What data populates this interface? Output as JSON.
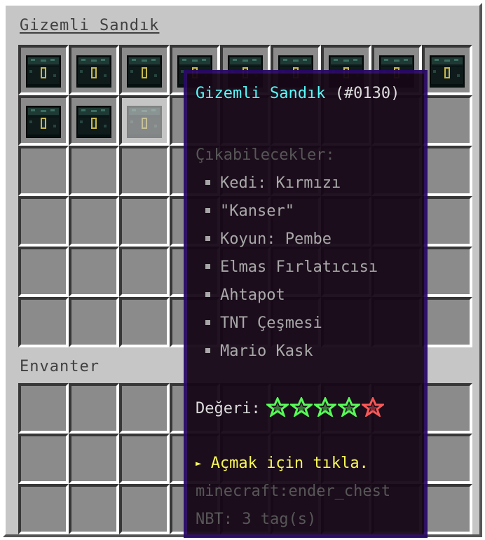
{
  "window": {
    "chest_title": "Gizemli Sandık",
    "inventory_title": "Envanter"
  },
  "chest_grid": {
    "filled_slots": 11,
    "hover_slot": 11,
    "item": "ender-chest-icon"
  },
  "tooltip": {
    "name": "Gizemli Sandık",
    "id": "(#0130)",
    "drops_header": "Çıkabilecekler:",
    "drops": [
      "Kedi: Kırmızı",
      "\"Kanser\"",
      "Koyun: Pembe",
      "Elmas Fırlatıcısı",
      "Ahtapot",
      "TNT Çeşmesi",
      "Mario Kask"
    ],
    "value_label": "Değeri:",
    "rating": {
      "value": 4,
      "max": 5
    },
    "action_arrow": "►",
    "action": "Açmak için tıkla.",
    "item_id": "minecraft:ender_chest",
    "nbt": "NBT: 3 tag(s)"
  },
  "colors": {
    "name": "#55ffff",
    "header": "#555555",
    "drop_text": "#aaaaaa",
    "value_label": "#e0e0e0",
    "star_on": "#55ff55",
    "star_off": "#ff5555",
    "action": "#ffff55",
    "meta": "#555555"
  }
}
